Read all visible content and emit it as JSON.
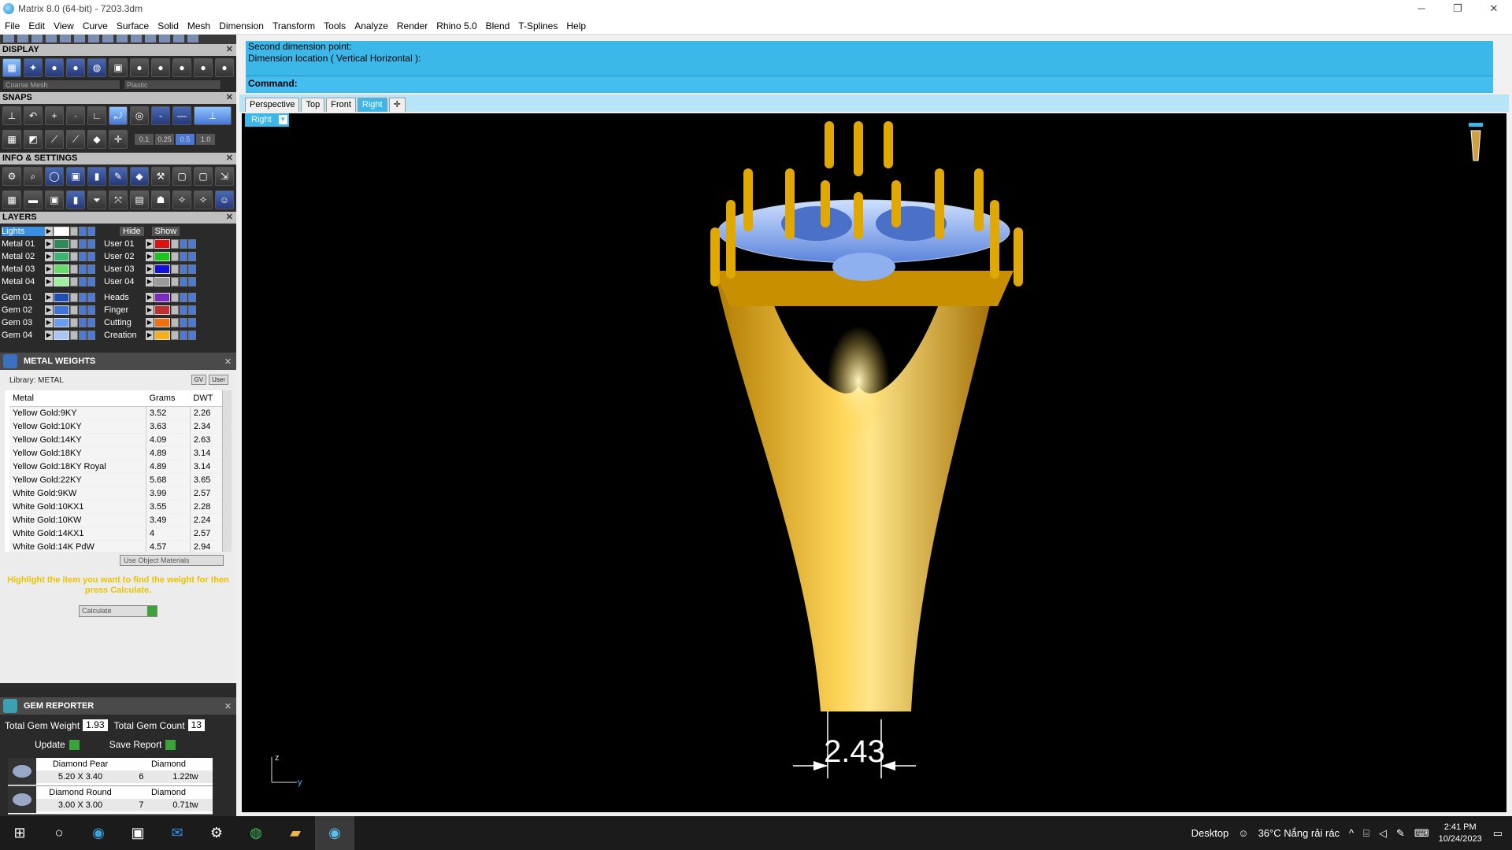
{
  "window": {
    "title": "Matrix 8.0 (64-bit) - 7203.3dm",
    "minimize": "─",
    "restore": "❐",
    "close": "✕"
  },
  "menu": [
    "File",
    "Edit",
    "View",
    "Curve",
    "Surface",
    "Solid",
    "Mesh",
    "Dimension",
    "Transform",
    "Tools",
    "Analyze",
    "Render",
    "Rhino 5.0",
    "Blend",
    "T-Splines",
    "Help"
  ],
  "display": {
    "title": "DISPLAY",
    "mesh_select": "Coarse Mesh",
    "material_select": "Plastic"
  },
  "snaps": {
    "title": "SNAPS",
    "values": [
      "0.1",
      "0.25",
      "0.5",
      "1.0"
    ]
  },
  "info": {
    "title": "INFO & SETTINGS"
  },
  "layers": {
    "title": "LAYERS",
    "lights": "Lights",
    "hide": "Hide",
    "show": "Show",
    "left": [
      {
        "name": "Metal 01",
        "color": "#2e8b57"
      },
      {
        "name": "Metal 02",
        "color": "#3cb371"
      },
      {
        "name": "Metal 03",
        "color": "#66dd66"
      },
      {
        "name": "Metal 04",
        "color": "#9ff09f"
      },
      {
        "name": "Gem 01",
        "color": "#1e4fb5"
      },
      {
        "name": "Gem 02",
        "color": "#3f74d8"
      },
      {
        "name": "Gem 03",
        "color": "#6b9cf0"
      },
      {
        "name": "Gem 04",
        "color": "#a9c7f5"
      }
    ],
    "right": [
      {
        "name": "User 01",
        "color": "#e01010"
      },
      {
        "name": "User 02",
        "color": "#19c619"
      },
      {
        "name": "User 03",
        "color": "#1010e0"
      },
      {
        "name": "User 04",
        "color": "#9a9a9a"
      },
      {
        "name": "Heads",
        "color": "#7b2bbf"
      },
      {
        "name": "Finger",
        "color": "#c03030"
      },
      {
        "name": "Cutting",
        "color": "#f07010"
      },
      {
        "name": "Creation",
        "color": "#f0b020"
      }
    ]
  },
  "metal_weights": {
    "title": "METAL WEIGHTS",
    "library": "Library: METAL",
    "toggle_gv": "GV",
    "toggle_user": "User",
    "columns": [
      "Metal",
      "Grams",
      "DWT"
    ],
    "rows": [
      [
        "Yellow Gold:9KY",
        "3.52",
        "2.26"
      ],
      [
        "Yellow Gold:10KY",
        "3.63",
        "2.34"
      ],
      [
        "Yellow Gold:14KY",
        "4.09",
        "2.63"
      ],
      [
        "Yellow Gold:18KY",
        "4.89",
        "3.14"
      ],
      [
        "Yellow Gold:18KY Royal",
        "4.89",
        "3.14"
      ],
      [
        "Yellow Gold:22KY",
        "5.68",
        "3.65"
      ],
      [
        "White Gold:9KW",
        "3.99",
        "2.57"
      ],
      [
        "White Gold:10KX1",
        "3.55",
        "2.28"
      ],
      [
        "White Gold:10KW",
        "3.49",
        "2.24"
      ],
      [
        "White Gold:14KX1",
        "4",
        "2.57"
      ],
      [
        "White Gold:14K PdW",
        "4.57",
        "2.94"
      ]
    ],
    "use_object_materials": "Use Object Materials",
    "hint": "Highlight the item you want to find the weight for then press Calculate.",
    "calculate": "Calculate"
  },
  "gem_reporter": {
    "title": "GEM REPORTER",
    "total_weight_label": "Total Gem Weight",
    "total_weight": "1.93",
    "total_count_label": "Total Gem Count",
    "total_count": "13",
    "update": "Update",
    "save_report": "Save Report",
    "gems": [
      {
        "name": "Diamond Pear",
        "material": "Diamond",
        "size": "5.20 X 3.40",
        "count": "6",
        "weight": "1.22tw"
      },
      {
        "name": "Diamond Round",
        "material": "Diamond",
        "size": "3.00 X 3.00",
        "count": "7",
        "weight": "0.71tw"
      }
    ]
  },
  "command": {
    "history": [
      "Second dimension point:",
      "Dimension location ( Vertical  Horizontal ):"
    ],
    "label": "Command:"
  },
  "tabs": [
    "Perspective",
    "Top",
    "Front",
    "Right"
  ],
  "active_tab": "Right",
  "viewport": {
    "label": "Right",
    "dimension": "2.43",
    "axis_z": "z",
    "axis_y": "y"
  },
  "taskbar": {
    "desktop": "Desktop",
    "weather": "36°C  Nắng rải rác",
    "time": "2:41 PM",
    "date": "10/24/2023"
  }
}
